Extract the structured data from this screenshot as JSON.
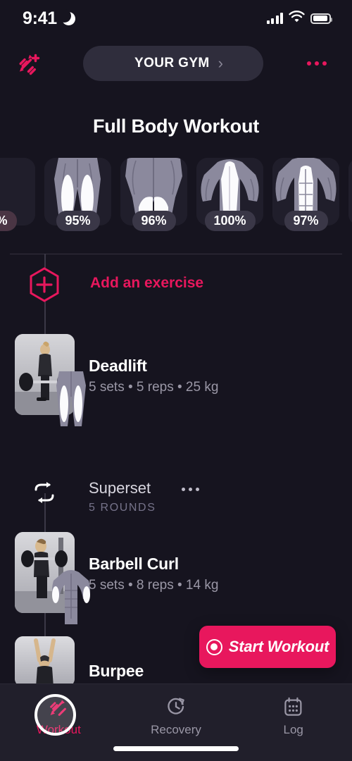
{
  "status_bar": {
    "time": "9:41",
    "moon_icon": "moon-icon",
    "signal_icon": "cellular-signal-icon",
    "wifi_icon": "wifi-icon",
    "battery_icon": "battery-icon"
  },
  "header": {
    "add_workout_icon": "dumbbell-plus-icon",
    "gym_label": "YOUR GYM",
    "gym_chevron": "›",
    "more_icon": "more-options-icon"
  },
  "page": {
    "title": "Full Body Workout"
  },
  "muscle_strip": {
    "cards": [
      {
        "name": "partial-left",
        "percent": "%",
        "highlight": true
      },
      {
        "name": "quads",
        "percent": "95%",
        "highlight": false
      },
      {
        "name": "glutes",
        "percent": "96%",
        "highlight": false
      },
      {
        "name": "back",
        "percent": "100%",
        "highlight": false
      },
      {
        "name": "abs",
        "percent": "97%",
        "highlight": false
      },
      {
        "name": "partial-right",
        "percent": "",
        "highlight": false
      }
    ]
  },
  "add_exercise": {
    "icon": "hexagon-plus-icon",
    "label": "Add an exercise"
  },
  "exercises": [
    {
      "name": "Deadlift",
      "meta": "5 sets • 5 reps • 25 kg",
      "thumbnail": "deadlift-thumbnail"
    },
    {
      "name": "Barbell Curl",
      "meta": "5 sets • 8 reps • 14 kg",
      "thumbnail": "barbell-curl-thumbnail"
    },
    {
      "name": "Burpee",
      "meta": "",
      "thumbnail": "burpee-thumbnail"
    }
  ],
  "superset": {
    "icon": "repeat-icon",
    "title": "Superset",
    "rounds": "5 ROUNDS",
    "more_icon": "superset-more-icon"
  },
  "start_workout": {
    "label": "Start Workout",
    "icon": "record-icon"
  },
  "tabbar": {
    "items": [
      {
        "label": "Workout",
        "icon": "dumbbell-icon",
        "active": true
      },
      {
        "label": "Recovery",
        "icon": "clock-refresh-icon",
        "active": false
      },
      {
        "label": "Log",
        "icon": "calendar-icon",
        "active": false
      }
    ]
  },
  "colors": {
    "background": "#16141f",
    "accent": "#e8175d",
    "pill": "#2f2d3c",
    "card": "#201e2b",
    "badge": "#3a3747",
    "muted_text": "#9a97a6",
    "tabbar": "#211f2b"
  }
}
